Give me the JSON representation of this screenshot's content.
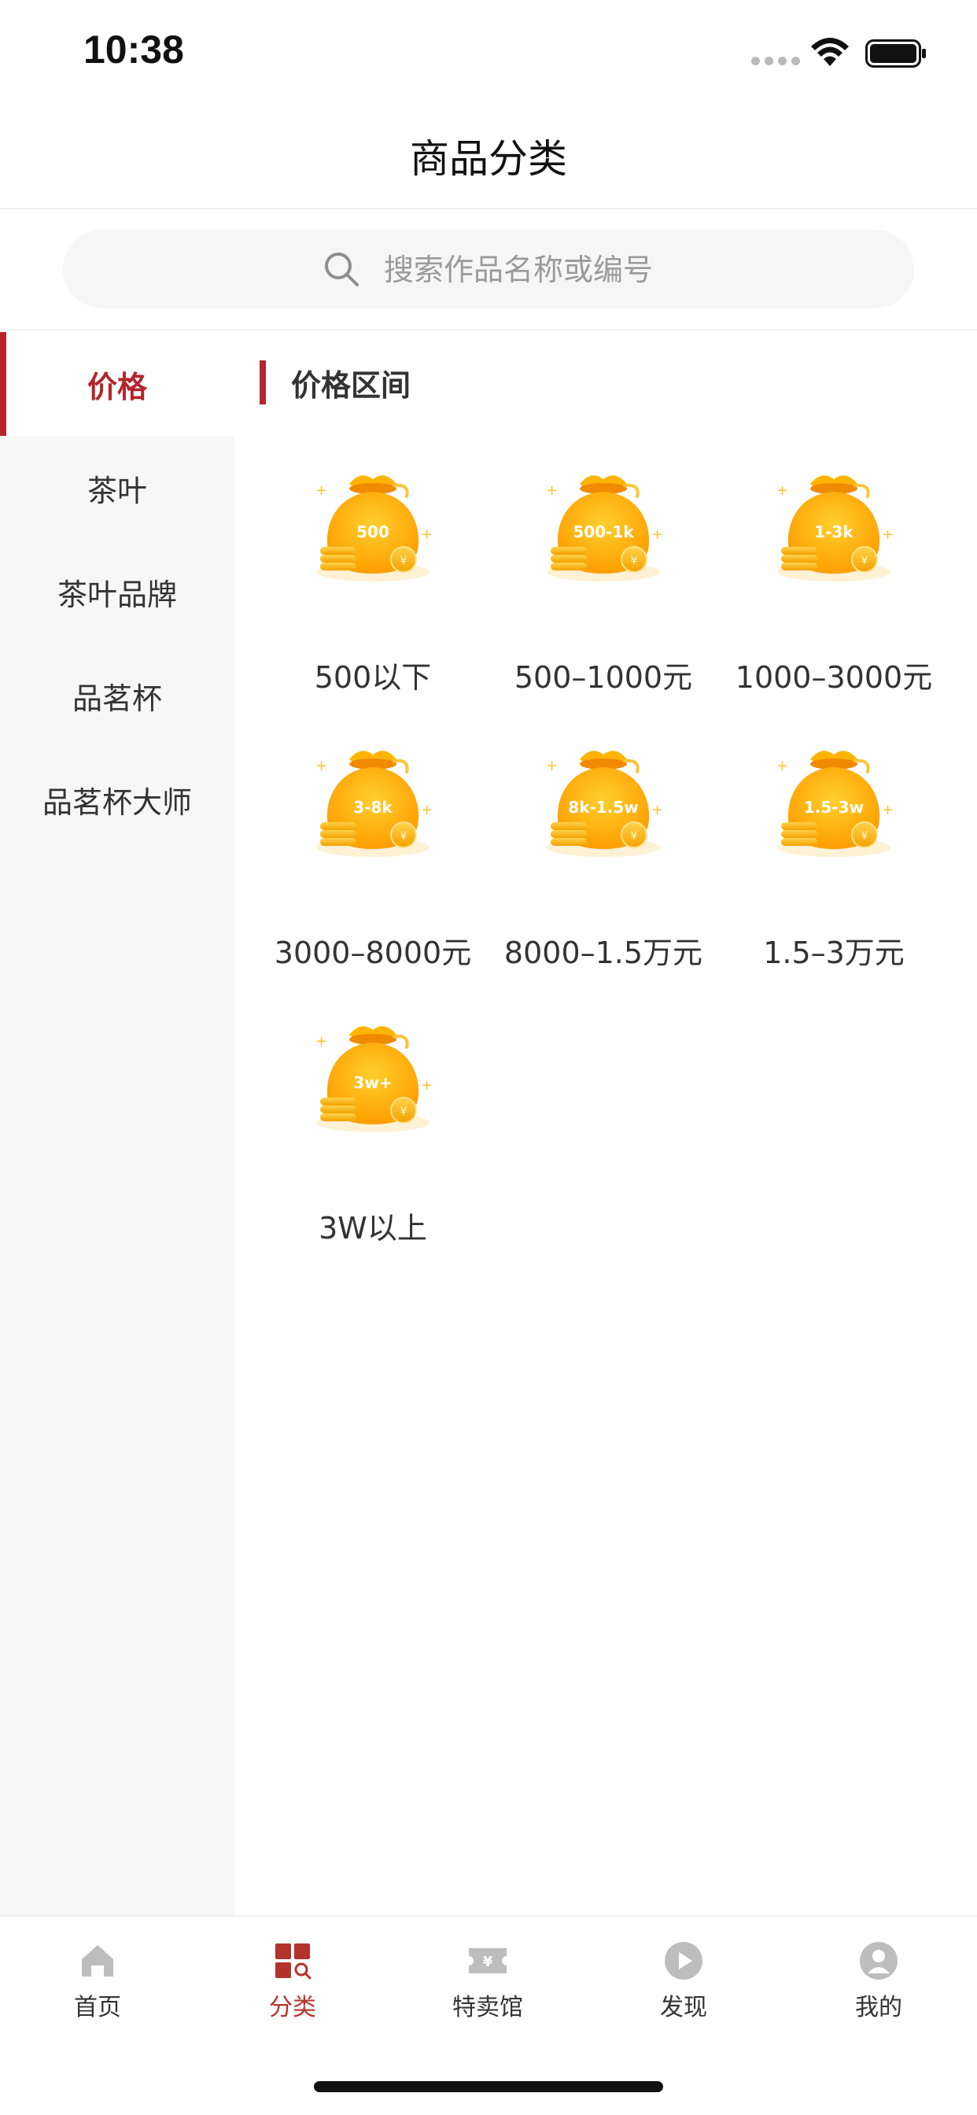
{
  "status_bar": {
    "time": "10:38",
    "icons": [
      "cellular-dots-icon",
      "wifi-icon",
      "battery-icon"
    ]
  },
  "header": {
    "title": "商品分类"
  },
  "search": {
    "placeholder": "搜索作品名称或编号",
    "icon": "search-icon"
  },
  "sidebar": {
    "items": [
      {
        "label": "价格",
        "active": true
      },
      {
        "label": "茶叶",
        "active": false
      },
      {
        "label": "茶叶品牌",
        "active": false
      },
      {
        "label": "品茗杯",
        "active": false
      },
      {
        "label": "品茗杯大师",
        "active": false
      }
    ]
  },
  "content": {
    "section_title": "价格区间",
    "tiles": [
      {
        "badge": "500",
        "label": "500以下",
        "icon": "money-bag-icon"
      },
      {
        "badge": "500-1k",
        "label": "500–1000元",
        "icon": "money-bag-icon"
      },
      {
        "badge": "1-3k",
        "label": "1000–3000元",
        "icon": "money-bag-icon"
      },
      {
        "badge": "3-8k",
        "label": "3000–8000元",
        "icon": "money-bag-icon"
      },
      {
        "badge": "8k-1.5w",
        "label": "8000–1.5万元",
        "icon": "money-bag-icon"
      },
      {
        "badge": "1.5-3w",
        "label": "1.5–3万元",
        "icon": "money-bag-icon"
      },
      {
        "badge": "3w+",
        "label": "3W以上",
        "icon": "money-bag-icon"
      }
    ]
  },
  "tab_bar": {
    "tabs": [
      {
        "label": "首页",
        "icon": "home-icon",
        "active": false
      },
      {
        "label": "分类",
        "icon": "category-icon",
        "active": true
      },
      {
        "label": "特卖馆",
        "icon": "ticket-icon",
        "active": false
      },
      {
        "label": "发现",
        "icon": "play-icon",
        "active": false
      },
      {
        "label": "我的",
        "icon": "user-icon",
        "active": false
      }
    ]
  },
  "colors": {
    "accent": "#b3262c",
    "tab_active": "#b4322b",
    "bag_gold": "#ffb300",
    "sidebar_bg": "#f7f7f7"
  }
}
